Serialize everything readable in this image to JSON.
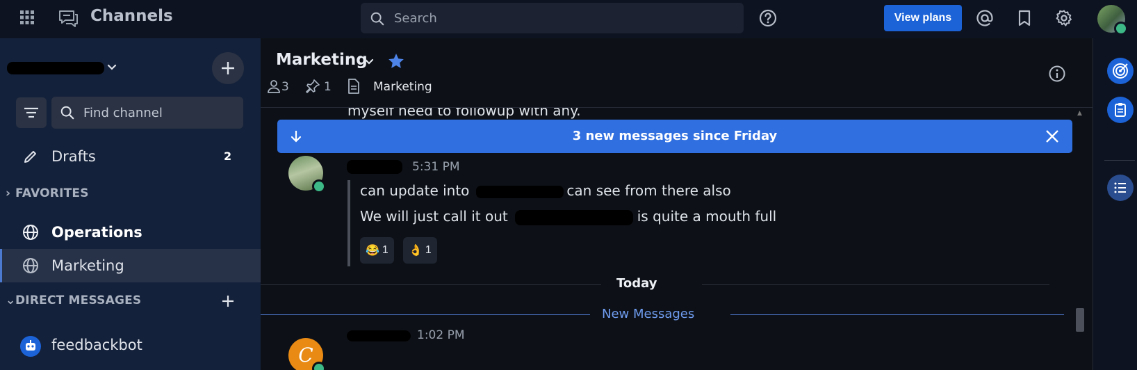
{
  "topbar": {
    "product_name": "Channels",
    "search_placeholder": "Search",
    "view_plans_label": "View plans"
  },
  "sidebar": {
    "find_channel_placeholder": "Find channel",
    "drafts": {
      "label": "Drafts",
      "count": "2"
    },
    "favorites_header": "FAVORITES",
    "favorites": [
      {
        "label": "Operations",
        "icon": "globe-icon",
        "bold": true
      },
      {
        "label": "Marketing",
        "icon": "globe-icon",
        "active": true
      }
    ],
    "dm_header": "DIRECT MESSAGES",
    "dms": [
      {
        "label": "feedbackbot",
        "icon": "bot-icon"
      }
    ]
  },
  "channel": {
    "name": "Marketing",
    "member_count": "3",
    "pinned_count": "1",
    "header_text": "Marketing"
  },
  "messages": {
    "partial_line": "myself need to followup with any.",
    "new_banner": "3 new messages since Friday",
    "post1": {
      "time": "5:31 PM",
      "line1_a": "can update into",
      "line1_b": "can see from there also",
      "line2_a": "We will just call it out",
      "line2_b": "is quite a mouth full",
      "reactions": [
        {
          "emoji": "😂",
          "count": "1"
        },
        {
          "emoji": "👌",
          "count": "1"
        }
      ]
    },
    "today_label": "Today",
    "new_messages_label": "New Messages",
    "post2": {
      "avatar_letter": "C",
      "time": "1:02 PM"
    }
  },
  "colors": {
    "accent": "#1c63d8",
    "banner": "#2f6fe0",
    "online": "#3db887",
    "avatar_orange": "#e88a14"
  }
}
